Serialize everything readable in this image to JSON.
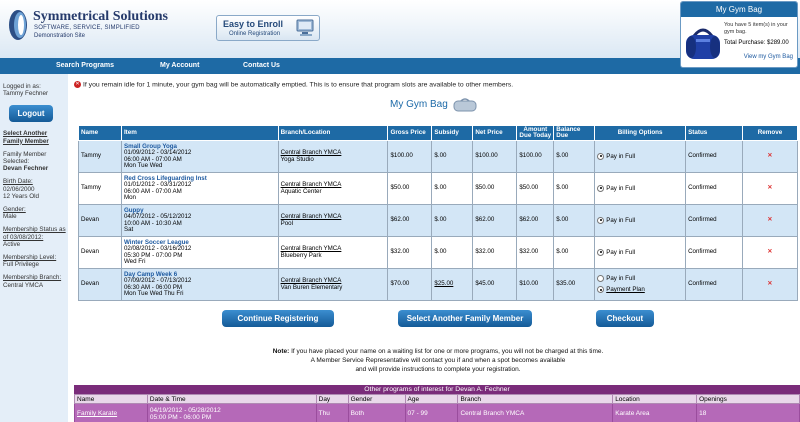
{
  "header": {
    "company": "Symmetrical Solutions",
    "tagline": "SOFTWARE, SERVICE, SIMPLIFIED",
    "site": "Demonstration Site",
    "enroll_title": "Easy to Enroll",
    "enroll_sub": "Online Registration"
  },
  "nav": [
    "Search Programs",
    "My Account",
    "Contact Us"
  ],
  "gym_bag_widget": {
    "title": "My Gym Bag",
    "summary": "You have 5 item(s) in your gym bag.",
    "total": "Total Purchase: $289.00",
    "link": "View my Gym Bag"
  },
  "sidebar": {
    "logged_in_label": "Logged in as:",
    "user": "Tammy Fechner",
    "logout": "Logout",
    "select_family": "Select Another Family Member",
    "member_selected_label": "Family Member Selected:",
    "member_name": "Devan Fechner",
    "birth_label": "Birth Date:",
    "birth_date": "02/06/2000",
    "age": "12 Years Old",
    "gender_label": "Gender:",
    "gender": "Male",
    "membership_status_label": "Membership Status as of 03/08/2012:",
    "membership_status": "Active",
    "membership_level_label": "Membership Level:",
    "membership_level": "Full Privilege",
    "membership_branch_label": "Membership Branch:",
    "membership_branch": "Central YMCA"
  },
  "notice": "If you remain idle for 1 minute, your gym bag will be automatically emptied. This is to ensure that program slots are available to other members.",
  "page_title": "My Gym Bag",
  "table": {
    "headers": [
      "Name",
      "Item",
      "Branch/Location",
      "Gross Price",
      "Subsidy",
      "Net Price",
      "Amount Due Today",
      "Balance Due",
      "Billing Options",
      "Status",
      "Remove"
    ],
    "rows": [
      {
        "name": "Tammy",
        "item": "Small Group Yoga",
        "dates": "01/09/2012 - 03/14/2012",
        "time": "06:00 AM - 07:00 AM",
        "days": "Mon Tue Wed",
        "branch": "Central Branch YMCA",
        "location": "Yoga Studio",
        "gross": "$100.00",
        "subsidy": "$.00",
        "net": "$100.00",
        "due_today": "$100.00",
        "balance": "$.00",
        "billing": [
          "Pay in Full"
        ],
        "status": "Confirmed",
        "remove": "✕"
      },
      {
        "name": "Tammy",
        "item": "Red Cross Lifeguarding Inst",
        "dates": "01/01/2012 - 03/31/2012",
        "time": "06:00 AM - 07:00 AM",
        "days": "Mon",
        "branch": "Central Branch YMCA",
        "location": "Aquatic Center",
        "gross": "$50.00",
        "subsidy": "$.00",
        "net": "$50.00",
        "due_today": "$50.00",
        "balance": "$.00",
        "billing": [
          "Pay in Full"
        ],
        "status": "Confirmed",
        "remove": "✕"
      },
      {
        "name": "Devan",
        "item": "Guppy",
        "dates": "04/07/2012 - 05/12/2012",
        "time": "10:00 AM - 10:30 AM",
        "days": "Sat",
        "branch": "Central Branch YMCA",
        "location": "Pool",
        "gross": "$62.00",
        "subsidy": "$.00",
        "net": "$62.00",
        "due_today": "$62.00",
        "balance": "$.00",
        "billing": [
          "Pay in Full"
        ],
        "status": "Confirmed",
        "remove": "✕"
      },
      {
        "name": "Devan",
        "item": "Winter Soccer League",
        "dates": "02/08/2012 - 03/16/2012",
        "time": "05:30 PM - 07:00 PM",
        "days": "Wed Fri",
        "branch": "Central Branch YMCA",
        "location": "Blueberry Park",
        "gross": "$32.00",
        "subsidy": "$.00",
        "net": "$32.00",
        "due_today": "$32.00",
        "balance": "$.00",
        "billing": [
          "Pay in Full"
        ],
        "status": "Confirmed",
        "remove": "✕"
      },
      {
        "name": "Devan",
        "item": "Day Camp Week 6",
        "dates": "07/09/2012 - 07/13/2012",
        "time": "06:30 AM - 06:00 PM",
        "days": "Mon Tue Wed Thu Fri",
        "branch": "Central Branch YMCA",
        "location": "Van Buren Elementary",
        "gross": "$70.00",
        "subsidy": "$25.00",
        "net": "$45.00",
        "due_today": "$10.00",
        "balance": "$35.00",
        "billing": [
          "Pay in Full",
          "Payment Plan"
        ],
        "status": "Confirmed",
        "remove": "✕"
      }
    ]
  },
  "buttons": {
    "continue": "Continue Registering",
    "select_family": "Select Another Family Member",
    "checkout": "Checkout"
  },
  "note": {
    "label": "Note:",
    "line1": "If you have placed your name on a waiting list for one or more programs, you will not be charged at this time.",
    "line2": "A Member Service Representative will contact you if and when a spot becomes available",
    "line3": "and will provide instructions to complete your registration."
  },
  "other_programs": {
    "title": "Other programs of interest for Devan A. Fechner",
    "headers": [
      "Name",
      "Date & Time",
      "Day",
      "Gender",
      "Age",
      "Branch",
      "Location",
      "Openings"
    ],
    "rows": [
      {
        "name": "Family Karate",
        "dates": "04/19/2012 - 05/28/2012",
        "time": "05:00 PM - 06:00 PM",
        "day": "Thu",
        "gender": "Both",
        "age": "07 - 99",
        "branch": "Central Branch YMCA",
        "location": "Karate Area",
        "openings": "18"
      }
    ]
  }
}
